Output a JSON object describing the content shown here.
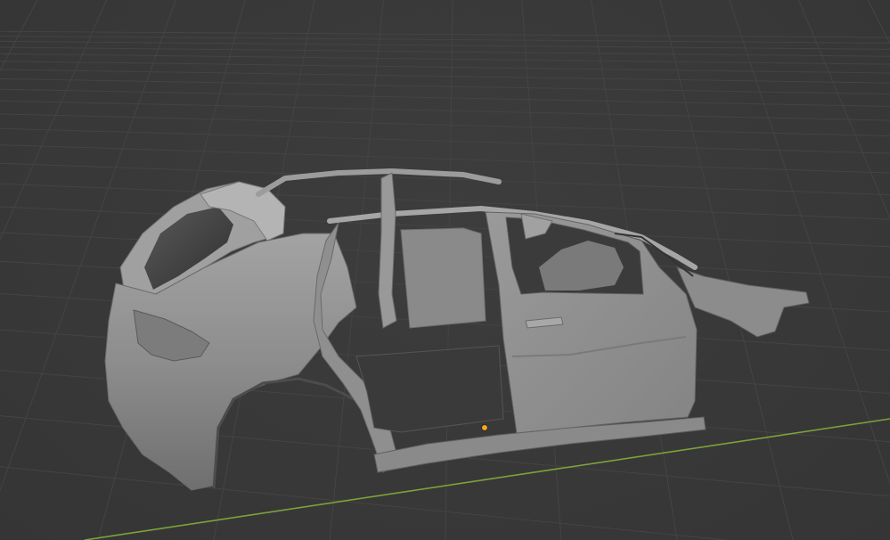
{
  "viewport": {
    "background_color": "#393939",
    "grid_color": "#444444",
    "x_axis_color": "#7da23a",
    "object": "car-body-shell",
    "object_color": "#8e8e8e",
    "origin_marker_color": "#f5a623"
  }
}
